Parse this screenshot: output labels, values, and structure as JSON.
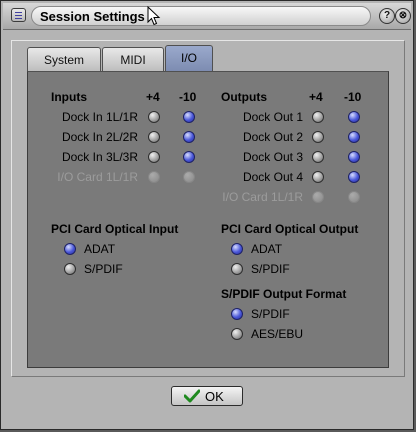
{
  "window": {
    "title": "Session Settings",
    "help_label": "?",
    "close_label": "⊗"
  },
  "tabs": [
    {
      "label": "System",
      "active": false
    },
    {
      "label": "MIDI",
      "active": false
    },
    {
      "label": "I/O",
      "active": true
    }
  ],
  "inputs": {
    "header": "Inputs",
    "col_plus4": "+4",
    "col_minus10": "-10",
    "rows": [
      {
        "label": "Dock In 1L/1R",
        "selected": "-10",
        "enabled": true
      },
      {
        "label": "Dock In 2L/2R",
        "selected": "-10",
        "enabled": true
      },
      {
        "label": "Dock In 3L/3R",
        "selected": "-10",
        "enabled": true
      },
      {
        "label": "I/O Card 1L/1R",
        "selected": "-10",
        "enabled": false
      }
    ]
  },
  "outputs": {
    "header": "Outputs",
    "col_plus4": "+4",
    "col_minus10": "-10",
    "rows": [
      {
        "label": "Dock Out 1",
        "selected": "-10",
        "enabled": true
      },
      {
        "label": "Dock Out 2",
        "selected": "-10",
        "enabled": true
      },
      {
        "label": "Dock Out 3",
        "selected": "-10",
        "enabled": true
      },
      {
        "label": "Dock Out 4",
        "selected": "-10",
        "enabled": true
      },
      {
        "label": "I/O Card 1L/1R",
        "selected": "-10",
        "enabled": false
      }
    ]
  },
  "pci_optical_input": {
    "header": "PCI Card Optical Input",
    "options": [
      {
        "label": "ADAT",
        "selected": true
      },
      {
        "label": "S/PDIF",
        "selected": false
      }
    ]
  },
  "pci_optical_output": {
    "header": "PCI Card Optical Output",
    "options": [
      {
        "label": "ADAT",
        "selected": true
      },
      {
        "label": "S/PDIF",
        "selected": false
      }
    ]
  },
  "spdif_output_format": {
    "header": "S/PDIF Output Format",
    "options": [
      {
        "label": "S/PDIF",
        "selected": true
      },
      {
        "label": "AES/EBU",
        "selected": false
      }
    ]
  },
  "ok_button": {
    "label": "OK"
  },
  "colors": {
    "radio_selected": "#4a57d8",
    "active_tab": "#8898c0"
  }
}
